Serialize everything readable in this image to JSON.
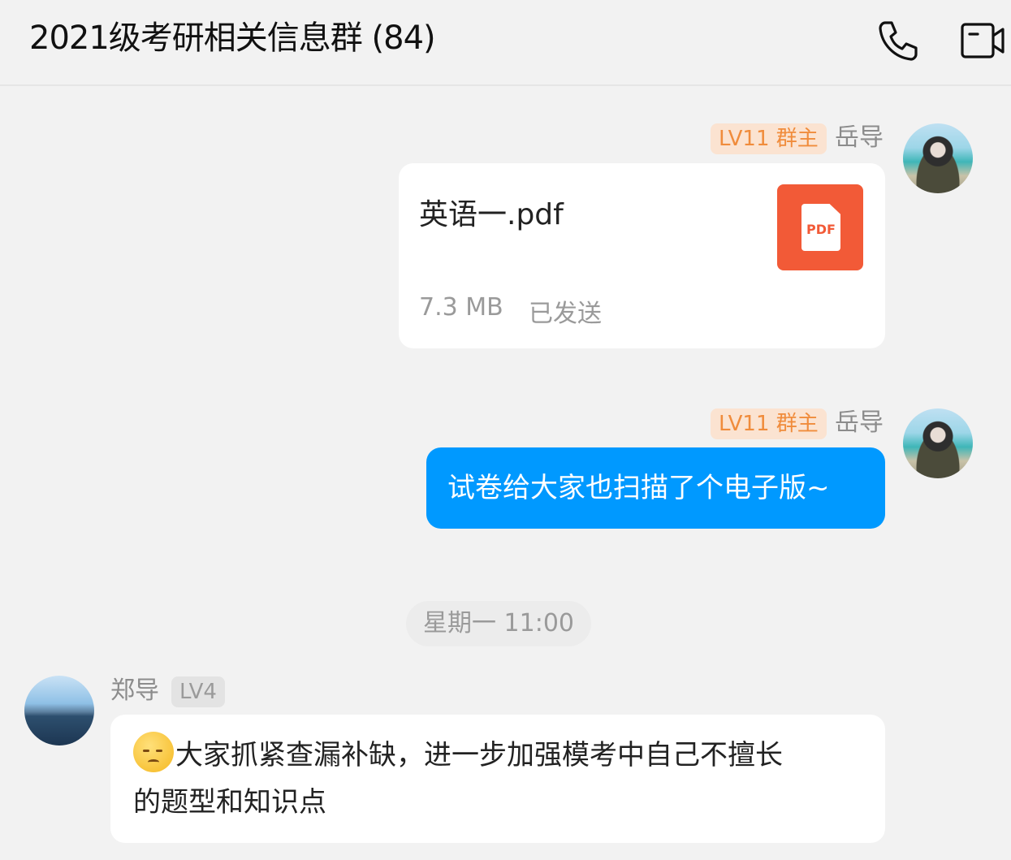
{
  "header": {
    "title": "2021级考研相关信息群 (84)",
    "phone_icon": "phone-icon",
    "video_icon": "video-camera-icon"
  },
  "messages": [
    {
      "sender": "岳导",
      "badge": "LV11 群主",
      "type": "file",
      "file_name": "英语一.pdf",
      "file_icon_label": "PDF",
      "file_size": "7.3 MB",
      "status": "已发送"
    },
    {
      "sender": "岳导",
      "badge": "LV11 群主",
      "type": "text",
      "text": "试卷给大家也扫描了个电子版~"
    },
    {
      "type": "timestamp",
      "text": "星期一 11:00"
    },
    {
      "sender": "郑导",
      "badge": "LV4",
      "type": "text",
      "line1": "大家抓紧查漏补缺，进一步加强模考中自己不擅长",
      "line2": "的题型和知识点"
    }
  ],
  "colors": {
    "accent_blue": "#0099ff",
    "owner_badge_text": "#f08c3c",
    "owner_badge_bg": "#fbe3d1",
    "pdf_red": "#f25a37"
  }
}
